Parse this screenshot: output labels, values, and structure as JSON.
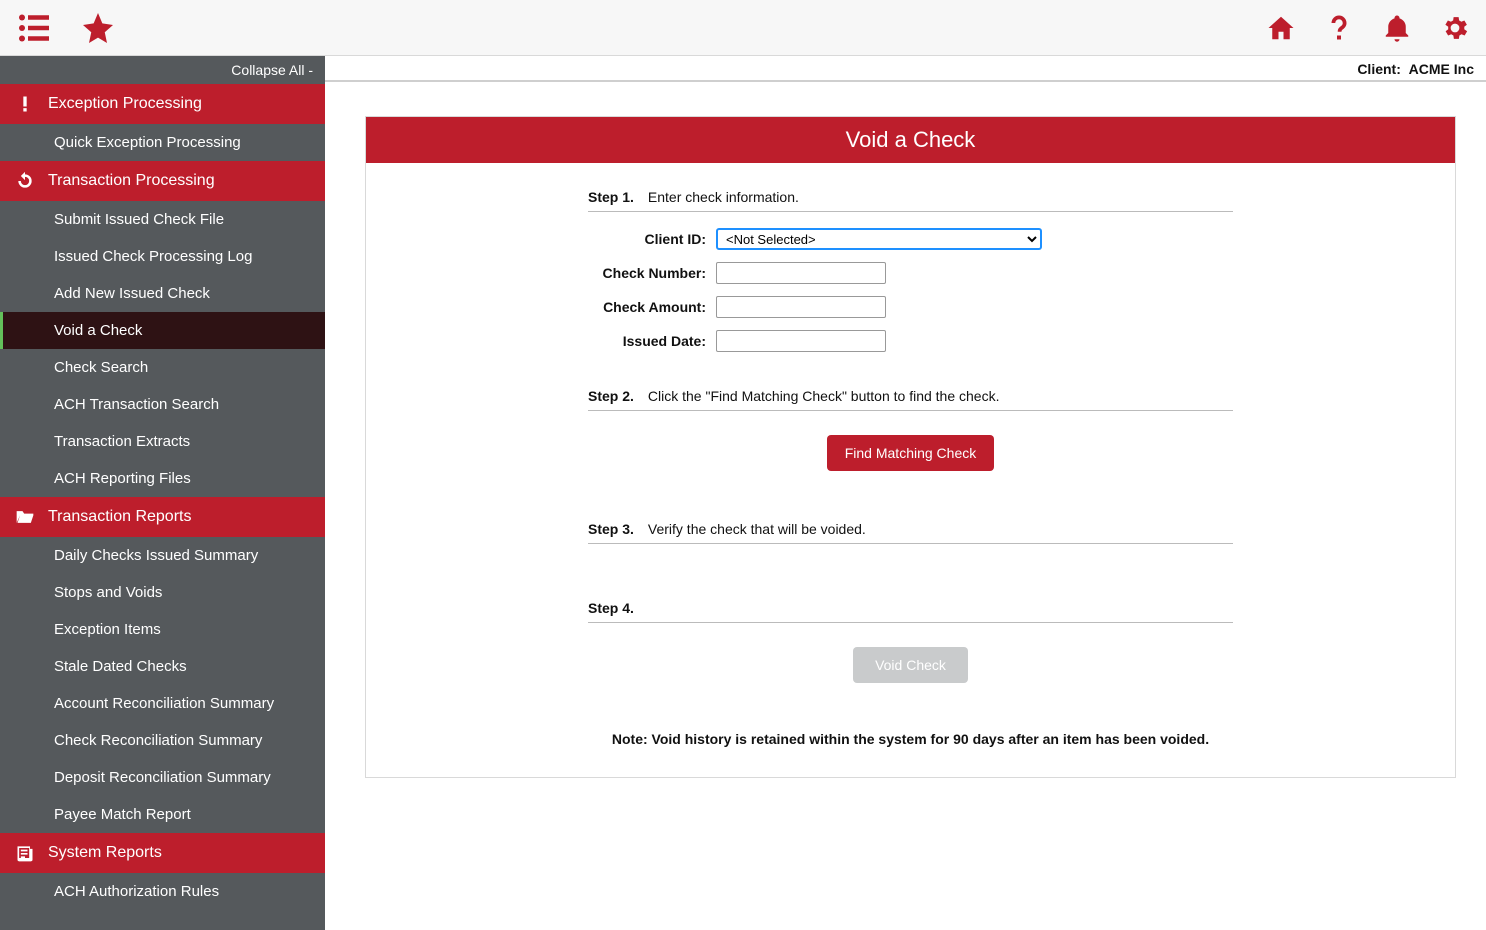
{
  "header": {
    "client_label": "Client:",
    "client_name": "ACME Inc"
  },
  "sidebar": {
    "collapse_label": "Collapse All -",
    "sections": [
      {
        "title": "Exception Processing",
        "items": [
          {
            "label": "Quick Exception Processing",
            "active": false
          }
        ]
      },
      {
        "title": "Transaction Processing",
        "items": [
          {
            "label": "Submit Issued Check File",
            "active": false
          },
          {
            "label": "Issued Check Processing Log",
            "active": false
          },
          {
            "label": "Add New Issued Check",
            "active": false
          },
          {
            "label": "Void a Check",
            "active": true
          },
          {
            "label": "Check Search",
            "active": false
          },
          {
            "label": "ACH Transaction Search",
            "active": false
          },
          {
            "label": "Transaction Extracts",
            "active": false
          },
          {
            "label": "ACH Reporting Files",
            "active": false
          }
        ]
      },
      {
        "title": "Transaction Reports",
        "items": [
          {
            "label": "Daily Checks Issued Summary",
            "active": false
          },
          {
            "label": "Stops and Voids",
            "active": false
          },
          {
            "label": "Exception Items",
            "active": false
          },
          {
            "label": "Stale Dated Checks",
            "active": false
          },
          {
            "label": "Account Reconciliation Summary",
            "active": false
          },
          {
            "label": "Check Reconciliation Summary",
            "active": false
          },
          {
            "label": "Deposit Reconciliation Summary",
            "active": false
          },
          {
            "label": "Payee Match Report",
            "active": false
          }
        ]
      },
      {
        "title": "System Reports",
        "items": [
          {
            "label": "ACH Authorization Rules",
            "active": false
          }
        ]
      }
    ]
  },
  "page": {
    "title": "Void a Check",
    "step1_label": "Step 1.",
    "step1_text": "Enter check information.",
    "fields": {
      "client_id_label": "Client ID:",
      "client_id_value": "<Not Selected>",
      "check_number_label": "Check Number:",
      "check_amount_label": "Check Amount:",
      "issued_date_label": "Issued Date:"
    },
    "step2_label": "Step 2.",
    "step2_text": "Click the \"Find Matching Check\" button to find the check.",
    "find_button": "Find Matching Check",
    "step3_label": "Step 3.",
    "step3_text": "Verify the check that will be voided.",
    "step4_label": "Step 4.",
    "void_button": "Void Check",
    "note": "Note: Void history is retained within the system for 90 days after an item has been voided."
  }
}
